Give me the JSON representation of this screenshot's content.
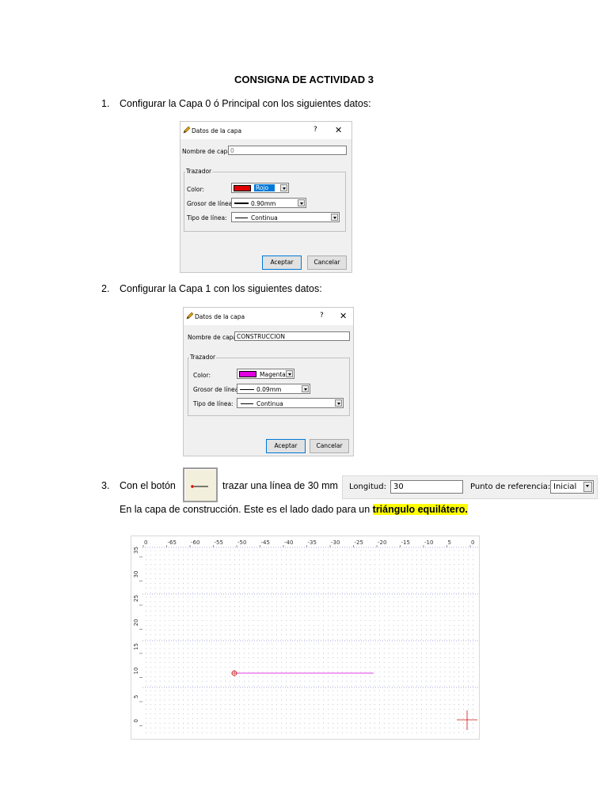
{
  "document": {
    "title": "CONSIGNA DE ACTIVIDAD 3",
    "step1": {
      "num": "1.",
      "text": "Configurar la Capa 0 ó Principal con los siguientes datos:"
    },
    "step2": {
      "num": "2.",
      "text": "Configurar la Capa 1 con los siguientes datos:"
    },
    "step3": {
      "num": "3.",
      "before": "Con el botón",
      "after": "trazar una línea de 30 mm"
    },
    "step3_line2": {
      "text": "En la capa de construcción. Este es el lado dado para un ",
      "highlight": "triángulo equilátero."
    }
  },
  "dialog1": {
    "title": "Datos de la capa",
    "help": "?",
    "close": "✕",
    "name_label": "Nombre de capa:",
    "name_value": "0",
    "group": "Trazador",
    "color_label": "Color:",
    "color_value": "Rojo",
    "color_swatch": "#e00000",
    "width_label": "Grosor de línea:",
    "width_value": "0.90mm",
    "type_label": "Tipo de línea:",
    "type_value": "Continua",
    "ok": "Aceptar",
    "cancel": "Cancelar"
  },
  "dialog2": {
    "title": "Datos de la capa",
    "help": "?",
    "close": "✕",
    "name_label": "Nombre de capa:",
    "name_value": "CONSTRUCCION",
    "group": "Trazador",
    "color_label": "Color:",
    "color_value": "Magenta",
    "color_swatch": "#e000e0",
    "width_label": "Grosor de línea:",
    "width_value": "0.09mm",
    "type_label": "Tipo de línea:",
    "type_value": "Continua",
    "ok": "Aceptar",
    "cancel": "Cancelar"
  },
  "toolbar": {
    "length_label": "Longitud:",
    "length_value": "30",
    "ref_label": "Punto de referencia:",
    "ref_value": "Inicial"
  },
  "canvas": {
    "x_ticks": [
      "0",
      "-65",
      "-60",
      "-55",
      "-50",
      "-45",
      "-40",
      "-35",
      "-30",
      "-25",
      "-20",
      "-15",
      "-10",
      "5",
      "0"
    ],
    "y_ticks": [
      "35",
      "30",
      "25",
      "20",
      "15",
      "10",
      "5",
      "0"
    ],
    "line_color": "#e040e0",
    "marker_color": "#d01010"
  }
}
